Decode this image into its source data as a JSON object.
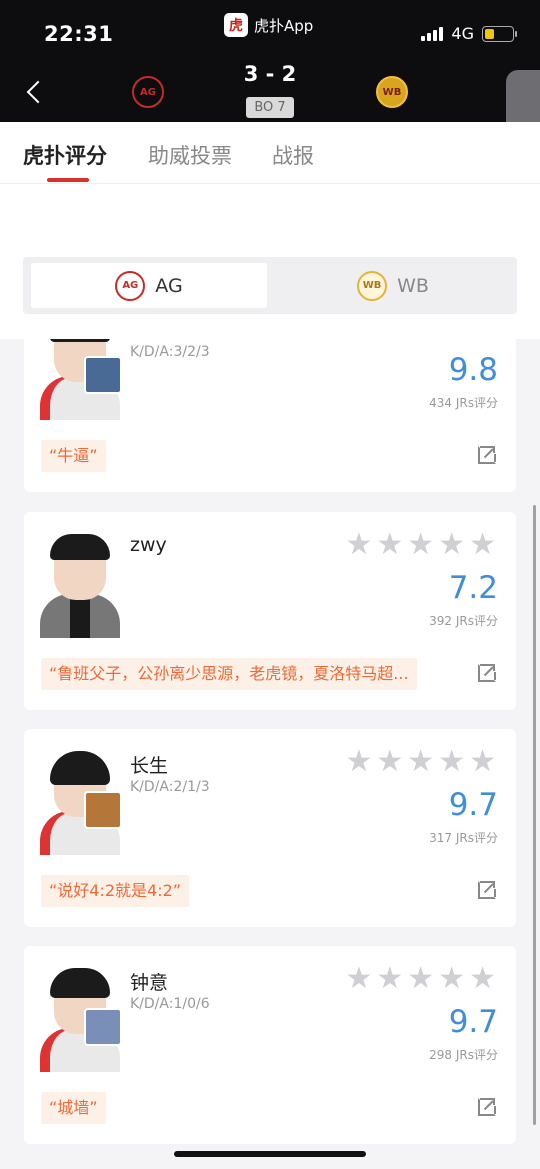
{
  "status": {
    "time": "22:31",
    "app_name": "虎扑App",
    "app_logo_char": "虎",
    "network": "4G",
    "battery_level": 0.35
  },
  "match": {
    "score": "3 - 2",
    "format": "BO 7",
    "team_left_logo": "AG",
    "team_right_logo": "WB"
  },
  "tabs": [
    {
      "label": "虎扑评分",
      "active": true
    },
    {
      "label": "助威投票",
      "active": false
    },
    {
      "label": "战报",
      "active": false
    }
  ],
  "team_switch": {
    "teams": [
      {
        "label": "AG",
        "logo": "AG",
        "selected": true
      },
      {
        "label": "WB",
        "logo": "WB",
        "selected": false
      }
    ]
  },
  "players": [
    {
      "name": "",
      "kda": "K/D/A:3/2/3",
      "rating": 0,
      "score": "9.8",
      "votes": "434 JRs评分",
      "comment": "“牛逼”",
      "hero_color": "#4a6a96"
    },
    {
      "name": "zwy",
      "kda": "",
      "rating": 0,
      "score": "7.2",
      "votes": "392 JRs评分",
      "comment": "“鲁班父子，公孙离少思源，老虎镜，夏洛特马超...",
      "hero_color": ""
    },
    {
      "name": "长生",
      "kda": "K/D/A:2/1/3",
      "rating": 0,
      "score": "9.7",
      "votes": "317 JRs评分",
      "comment": "“说好4:2就是4:2”",
      "hero_color": "#b5763a"
    },
    {
      "name": "钟意",
      "kda": "K/D/A:1/0/6",
      "rating": 0,
      "score": "9.7",
      "votes": "298 JRs评分",
      "comment": "“城墙”",
      "hero_color": "#7a8fb8"
    }
  ],
  "icons": {
    "back": "chevron-left-icon",
    "side_handle": "chevron-left-icon",
    "star": "star-icon",
    "share": "share-icon"
  },
  "colors": {
    "accent": "#d8302a",
    "score": "#3f8ed6",
    "comment_text": "#ea6a3a",
    "comment_bg": "#fdf1e7",
    "star_inactive": "#cfcfd4"
  }
}
